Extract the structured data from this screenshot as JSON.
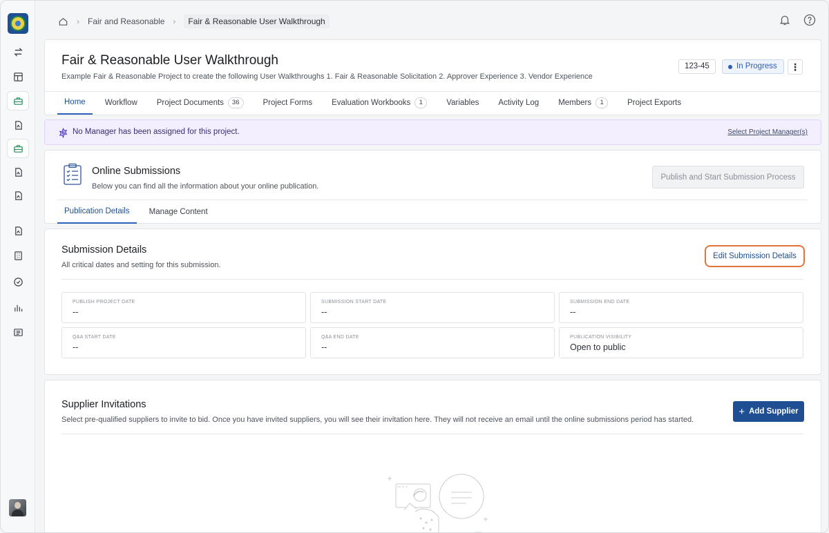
{
  "breadcrumb": {
    "home_icon": "home-icon",
    "items": [
      "Fair and Reasonable",
      "Fair & Reasonable User Walkthrough"
    ]
  },
  "topbar": {
    "icons": [
      "bell-icon",
      "help-icon"
    ]
  },
  "sidebar": {
    "icons": [
      "swap-icon",
      "layout-icon",
      "briefcase-icon",
      "document-icon",
      "briefcase-icon",
      "document-icon",
      "document-icon",
      "document-icon",
      "calculator-icon",
      "check-circle-icon",
      "bar-chart-icon",
      "list-card-icon"
    ]
  },
  "project": {
    "title": "Fair & Reasonable User Walkthrough",
    "description": "Example Fair & Reasonable Project to create the following User Walkthroughs 1. Fair & Reasonable Solicitation 2. Approver Experience 3. Vendor Experience",
    "number": "123-45",
    "status": "In Progress",
    "more_label": "⋮",
    "tabs": [
      {
        "label": "Home",
        "count": ""
      },
      {
        "label": "Workflow",
        "count": ""
      },
      {
        "label": "Project Documents",
        "count": "36"
      },
      {
        "label": "Project Forms",
        "count": ""
      },
      {
        "label": "Evaluation Workbooks",
        "count": "1"
      },
      {
        "label": "Variables",
        "count": ""
      },
      {
        "label": "Activity Log",
        "count": ""
      },
      {
        "label": "Members",
        "count": "1"
      },
      {
        "label": "Project Exports",
        "count": ""
      }
    ]
  },
  "notice": {
    "text": "No Manager has been assigned for this project.",
    "link": "Select Project Manager(s)"
  },
  "online": {
    "title": "Online Submissions",
    "description": "Below you can find all the information about your online publication.",
    "publish_button": "Publish and Start Submission Process",
    "tabs": [
      "Publication Details",
      "Manage Content"
    ]
  },
  "submission": {
    "title": "Submission Details",
    "description": "All critical dates and setting for this submission.",
    "edit_button": "Edit Submission Details",
    "fields": [
      {
        "label": "Publish Project Date",
        "value": "--"
      },
      {
        "label": "Submission Start Date",
        "value": "--"
      },
      {
        "label": "Submission End Date",
        "value": "--"
      },
      {
        "label": "Q&A Start Date",
        "value": "--"
      },
      {
        "label": "Q&A End Date",
        "value": "--"
      },
      {
        "label": "Publication Visibility",
        "value": "Open to public"
      }
    ]
  },
  "suppliers": {
    "title": "Supplier Invitations",
    "description": "Select pre-qualified suppliers to invite to bid. Once you have invited suppliers, you will see their invitation here. They will not receive an email until the online submissions period has started.",
    "add_button": "Add Supplier",
    "add_icon": "+"
  },
  "colors": {
    "accent": "#1e4f93",
    "highlight_border": "#e4733a",
    "notice_bg": "#f3efff"
  }
}
